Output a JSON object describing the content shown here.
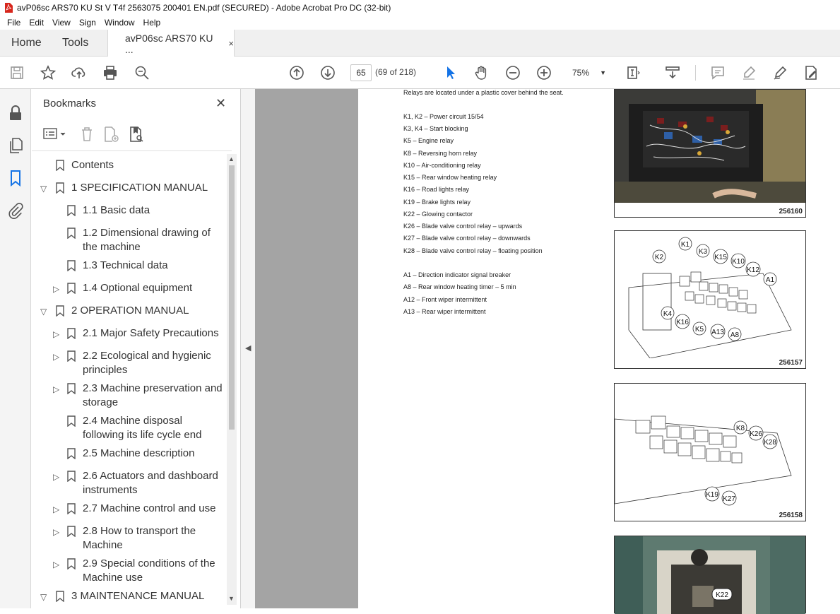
{
  "window": {
    "title": "avP06sc ARS70 KU St V T4f 2563075 200401 EN.pdf (SECURED) - Adobe Acrobat Pro DC (32-bit)"
  },
  "menu": [
    "File",
    "Edit",
    "View",
    "Sign",
    "Window",
    "Help"
  ],
  "tabs": {
    "home": "Home",
    "tools": "Tools",
    "doc": "avP06sc ARS70 KU ...",
    "close": "×"
  },
  "toolbar": {
    "page_current": "65",
    "page_count": "(69 of 218)",
    "zoom": "75%"
  },
  "bookmarks": {
    "title": "Bookmarks",
    "close": "✕",
    "items": [
      {
        "label": "Contents"
      },
      {
        "label": "1 SPECIFICATION MANUAL"
      },
      {
        "label": "1.1 Basic data"
      },
      {
        "label": "1.2 Dimensional drawing of"
      },
      {
        "label": "the machine"
      },
      {
        "label": "1.3 Technical data"
      },
      {
        "label": "1.4 Optional equipment"
      },
      {
        "label": "2 OPERATION MANUAL"
      },
      {
        "label": "2.1 Major Safety Precautions"
      },
      {
        "label": "2.2 Ecological and hygienic"
      },
      {
        "label": "principles"
      },
      {
        "label": "2.3 Machine preservation and"
      },
      {
        "label": "storage"
      },
      {
        "label": "2.4 Machine disposal"
      },
      {
        "label": "following its life cycle end"
      },
      {
        "label": "2.5 Machine description"
      },
      {
        "label": "2.6 Actuators and dashboard"
      },
      {
        "label": "instruments"
      },
      {
        "label": "2.7 Machine control and use"
      },
      {
        "label": "2.8 How to transport the"
      },
      {
        "label": "Machine"
      },
      {
        "label": "2.9 Special conditions of the"
      },
      {
        "label": "Machine use"
      },
      {
        "label": "3 MAINTENANCE MANUAL"
      }
    ]
  },
  "document": {
    "intro": "Relays are located under a plastic cover behind the seat.",
    "relays": [
      "K1, K2 – Power circuit 15/54",
      "K3, K4 – Start blocking",
      "K5 – Engine relay",
      "K8 – Reversing horn relay",
      "K10 – Air-conditioning relay",
      "K15 – Rear window heating relay",
      "K16 – Road lights relay",
      "K19 – Brake lights relay",
      "K22 – Glowing contactor",
      "K26 – Blade valve control relay – upwards",
      "K27 – Blade valve control relay – downwards",
      "K28 – Blade valve control relay – floating position"
    ],
    "others": [
      "A1 – Direction indicator signal breaker",
      "A8 – Rear window heating timer – 5 min",
      "A12 – Front wiper intermittent",
      "A13 – Rear wiper intermittent"
    ],
    "figures": {
      "fig1": "256160",
      "fig2": "256157",
      "fig3": "256158"
    },
    "fig2_labels": [
      "K1",
      "K3",
      "K15",
      "K10",
      "K12",
      "A1",
      "K2",
      "K4",
      "K16",
      "K5",
      "A13",
      "A8"
    ],
    "fig3_labels": [
      "K8",
      "K26",
      "K28",
      "K19",
      "K27"
    ],
    "fig4_label": "K22"
  },
  "colors": {
    "accent": "#1473e6",
    "pdf_red": "#d7261c"
  }
}
